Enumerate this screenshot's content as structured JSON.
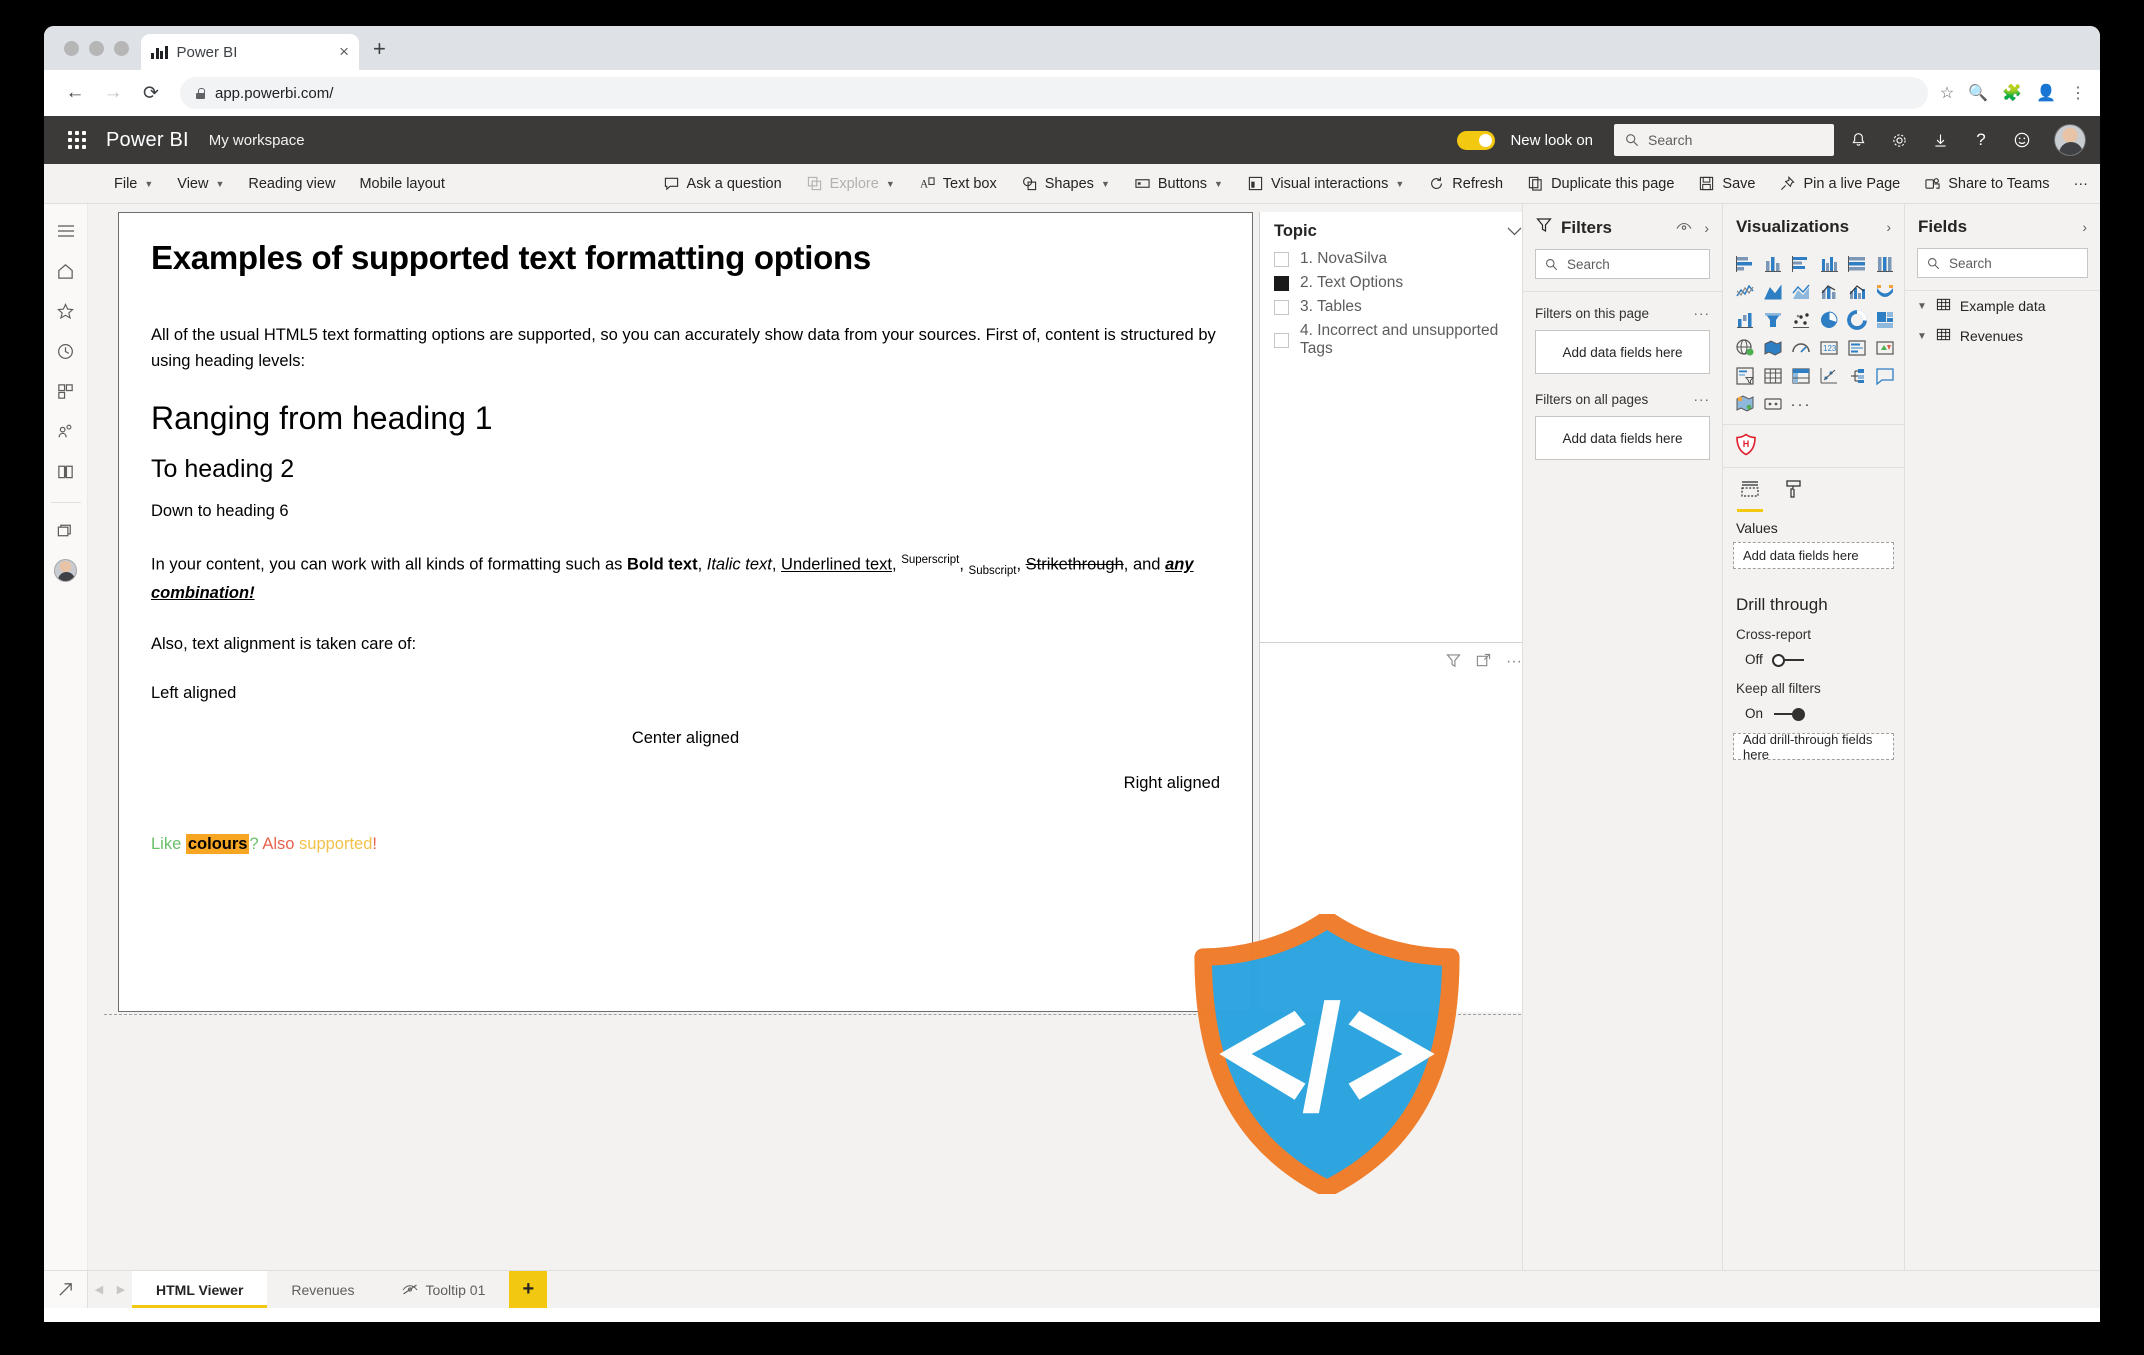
{
  "browser": {
    "tab_title": "Power BI",
    "url": "app.powerbi.com/",
    "new_tab_label": "+",
    "close_label": "×",
    "back_label": "←",
    "forward_label": "→",
    "reload_label": "⟳"
  },
  "header": {
    "brand": "Power BI",
    "workspace": "My workspace",
    "new_look_label": "New look on",
    "search_placeholder": "Search"
  },
  "ribbon": {
    "file": "File",
    "view": "View",
    "reading_view": "Reading view",
    "mobile_layout": "Mobile layout",
    "ask_a_question": "Ask a question",
    "explore": "Explore",
    "text_box": "Text box",
    "shapes": "Shapes",
    "buttons": "Buttons",
    "visual_interactions": "Visual interactions",
    "refresh": "Refresh",
    "duplicate_this_page": "Duplicate this page",
    "save": "Save",
    "pin_a_live_page": "Pin a live Page",
    "share_to_teams": "Share to Teams",
    "more": "···"
  },
  "report": {
    "title": "Examples of supported text formatting options",
    "intro": "All of the usual HTML5 text formatting options are supported, so you can accurately show data from your sources. First of, content is structured by using heading levels:",
    "heading1": "Ranging from heading 1",
    "heading2": "To heading 2",
    "heading6": "Down to heading 6",
    "formatting": {
      "lead": "In your content, you can work with all kinds of formatting such as ",
      "bold": "Bold text",
      "sep1": ", ",
      "italic": "Italic text",
      "sep2": ", ",
      "underline": "Underlined text",
      "sep3": ", ",
      "superscript": "Superscript",
      "sep4": ", ",
      "subscript": "Subscript",
      "sep5": ", ",
      "strikethrough": "Strikethrough",
      "sep6": ", and ",
      "combination": "any combination!"
    },
    "alignment_intro": "Also, text alignment is taken care of:",
    "left_aligned": "Left aligned",
    "center_aligned": "Center aligned",
    "right_aligned": "Right aligned",
    "colours": {
      "like": "Like ",
      "colours": "colours",
      "q": "? ",
      "also": "Also ",
      "supported": "supported",
      "bang": "!"
    },
    "colour_values": {
      "green": "#6abf69",
      "highlight_bg": "#f6a623",
      "red": "#e8614b",
      "yellow": "#f3c14b"
    }
  },
  "slicer": {
    "title": "Topic",
    "items": [
      {
        "label": "1. NovaSilva",
        "checked": false
      },
      {
        "label": "2. Text Options",
        "checked": true
      },
      {
        "label": "3. Tables",
        "checked": false
      },
      {
        "label": "4. Incorrect and unsupported Tags",
        "checked": false
      }
    ]
  },
  "filters_pane": {
    "title": "Filters",
    "search_placeholder": "Search",
    "on_this_page_label": "Filters on this page",
    "on_all_pages_label": "Filters on all pages",
    "dropzone_label": "Add data fields here",
    "dots": "···"
  },
  "visualizations_pane": {
    "title": "Visualizations",
    "icons": [
      "stacked-bar-chart-icon",
      "stacked-column-chart-icon",
      "clustered-bar-chart-icon",
      "clustered-column-chart-icon",
      "100-stacked-bar-chart-icon",
      "100-stacked-column-chart-icon",
      "line-chart-icon",
      "area-chart-icon",
      "stacked-area-chart-icon",
      "line-stacked-column-chart-icon",
      "line-clustered-column-chart-icon",
      "ribbon-chart-icon",
      "waterfall-chart-icon",
      "funnel-chart-icon",
      "scatter-chart-icon",
      "pie-chart-icon",
      "donut-chart-icon",
      "treemap-icon",
      "map-icon",
      "filled-map-icon",
      "gauge-icon",
      "card-icon",
      "multi-row-card-icon",
      "kpi-icon",
      "slicer-icon",
      "table-icon",
      "matrix-icon",
      "r-script-visual-icon",
      "key-influencers-icon",
      "q-and-a-icon",
      "arcgis-map-icon",
      "paginated-report-icon",
      "more-visuals-icon"
    ],
    "custom_visual": "html-viewer-shield-icon",
    "tabs": [
      "fields-tab-icon",
      "format-tab-icon"
    ],
    "values_label": "Values",
    "values_placeholder": "Add data fields here",
    "drill_through_title": "Drill through",
    "cross_report_label": "Cross-report",
    "cross_report_state": "Off",
    "keep_all_filters_label": "Keep all filters",
    "keep_all_filters_state": "On",
    "drill_placeholder": "Add drill-through fields here"
  },
  "fields_pane": {
    "title": "Fields",
    "search_placeholder": "Search",
    "tables": [
      "Example data",
      "Revenues"
    ]
  },
  "page_tabs": {
    "items": [
      {
        "label": "HTML Viewer",
        "active": true,
        "hidden": false
      },
      {
        "label": "Revenues",
        "active": false,
        "hidden": false
      },
      {
        "label": "Tooltip 01",
        "active": false,
        "hidden": true
      }
    ],
    "add_label": "+"
  },
  "watermark": {
    "name": "html-viewer-shield-logo",
    "shield_fill": "#2ca4df",
    "shield_border": "#ef7c2a",
    "glyph": "</>"
  }
}
